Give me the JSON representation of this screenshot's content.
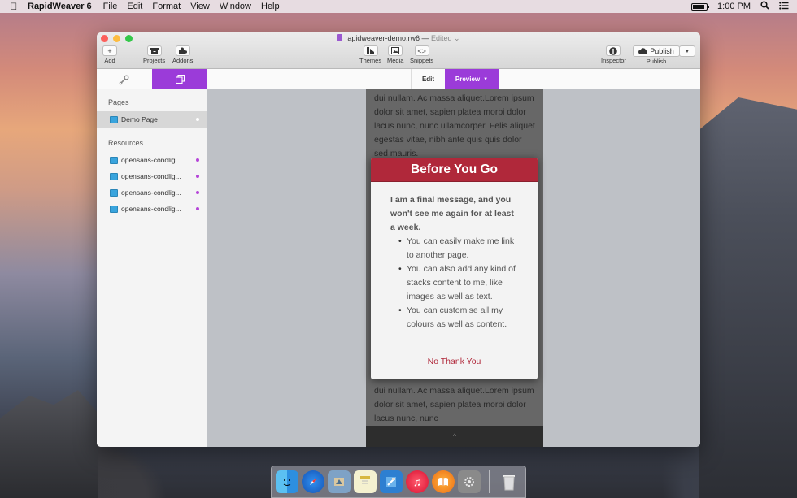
{
  "menubar": {
    "app_name": "RapidWeaver 6",
    "menus": [
      "File",
      "Edit",
      "Format",
      "View",
      "Window",
      "Help"
    ],
    "time": "1:00 PM"
  },
  "window": {
    "title": "rapidweaver-demo.rw6",
    "status": "Edited",
    "toolbar": {
      "add": "Add",
      "projects": "Projects",
      "addons": "Addons",
      "themes": "Themes",
      "media": "Media",
      "snippets": "Snippets",
      "inspector": "Inspector",
      "publish_button": "Publish",
      "publish_label": "Publish"
    },
    "modes": {
      "edit": "Edit",
      "preview": "Preview"
    }
  },
  "sidebar": {
    "pages_header": "Pages",
    "pages": [
      {
        "label": "Demo Page"
      }
    ],
    "resources_header": "Resources",
    "resources": [
      {
        "label": "opensans-condlig..."
      },
      {
        "label": "opensans-condlig..."
      },
      {
        "label": "opensans-condlig..."
      },
      {
        "label": "opensans-condlig..."
      }
    ]
  },
  "preview": {
    "top_text": "dui nullam. Ac massa aliquet.Lorem ipsum dolor sit amet, sapien platea morbi dolor lacus nunc, nunc ullamcorper. Felis aliquet egestas vitae, nibh ante quis quis dolor sed mauris.",
    "bottom_text": "dui nullam. Ac massa aliquet.Lorem ipsum dolor sit amet, sapien platea morbi dolor lacus nunc, nunc",
    "footer_glyph": "^",
    "modal": {
      "title": "Before You Go",
      "lead": "I am a final message, and you won't see me again for at least a week.",
      "bullets": [
        "You can easily make me link to another page.",
        "You can also add any kind of stacks content to me, like images as well as text.",
        "You can customise all my colours as well as content."
      ],
      "dismiss": "No Thank You"
    }
  },
  "colors": {
    "accent_purple": "#9b3bd9",
    "modal_red": "#b0283a"
  },
  "battery_level": 0.85
}
